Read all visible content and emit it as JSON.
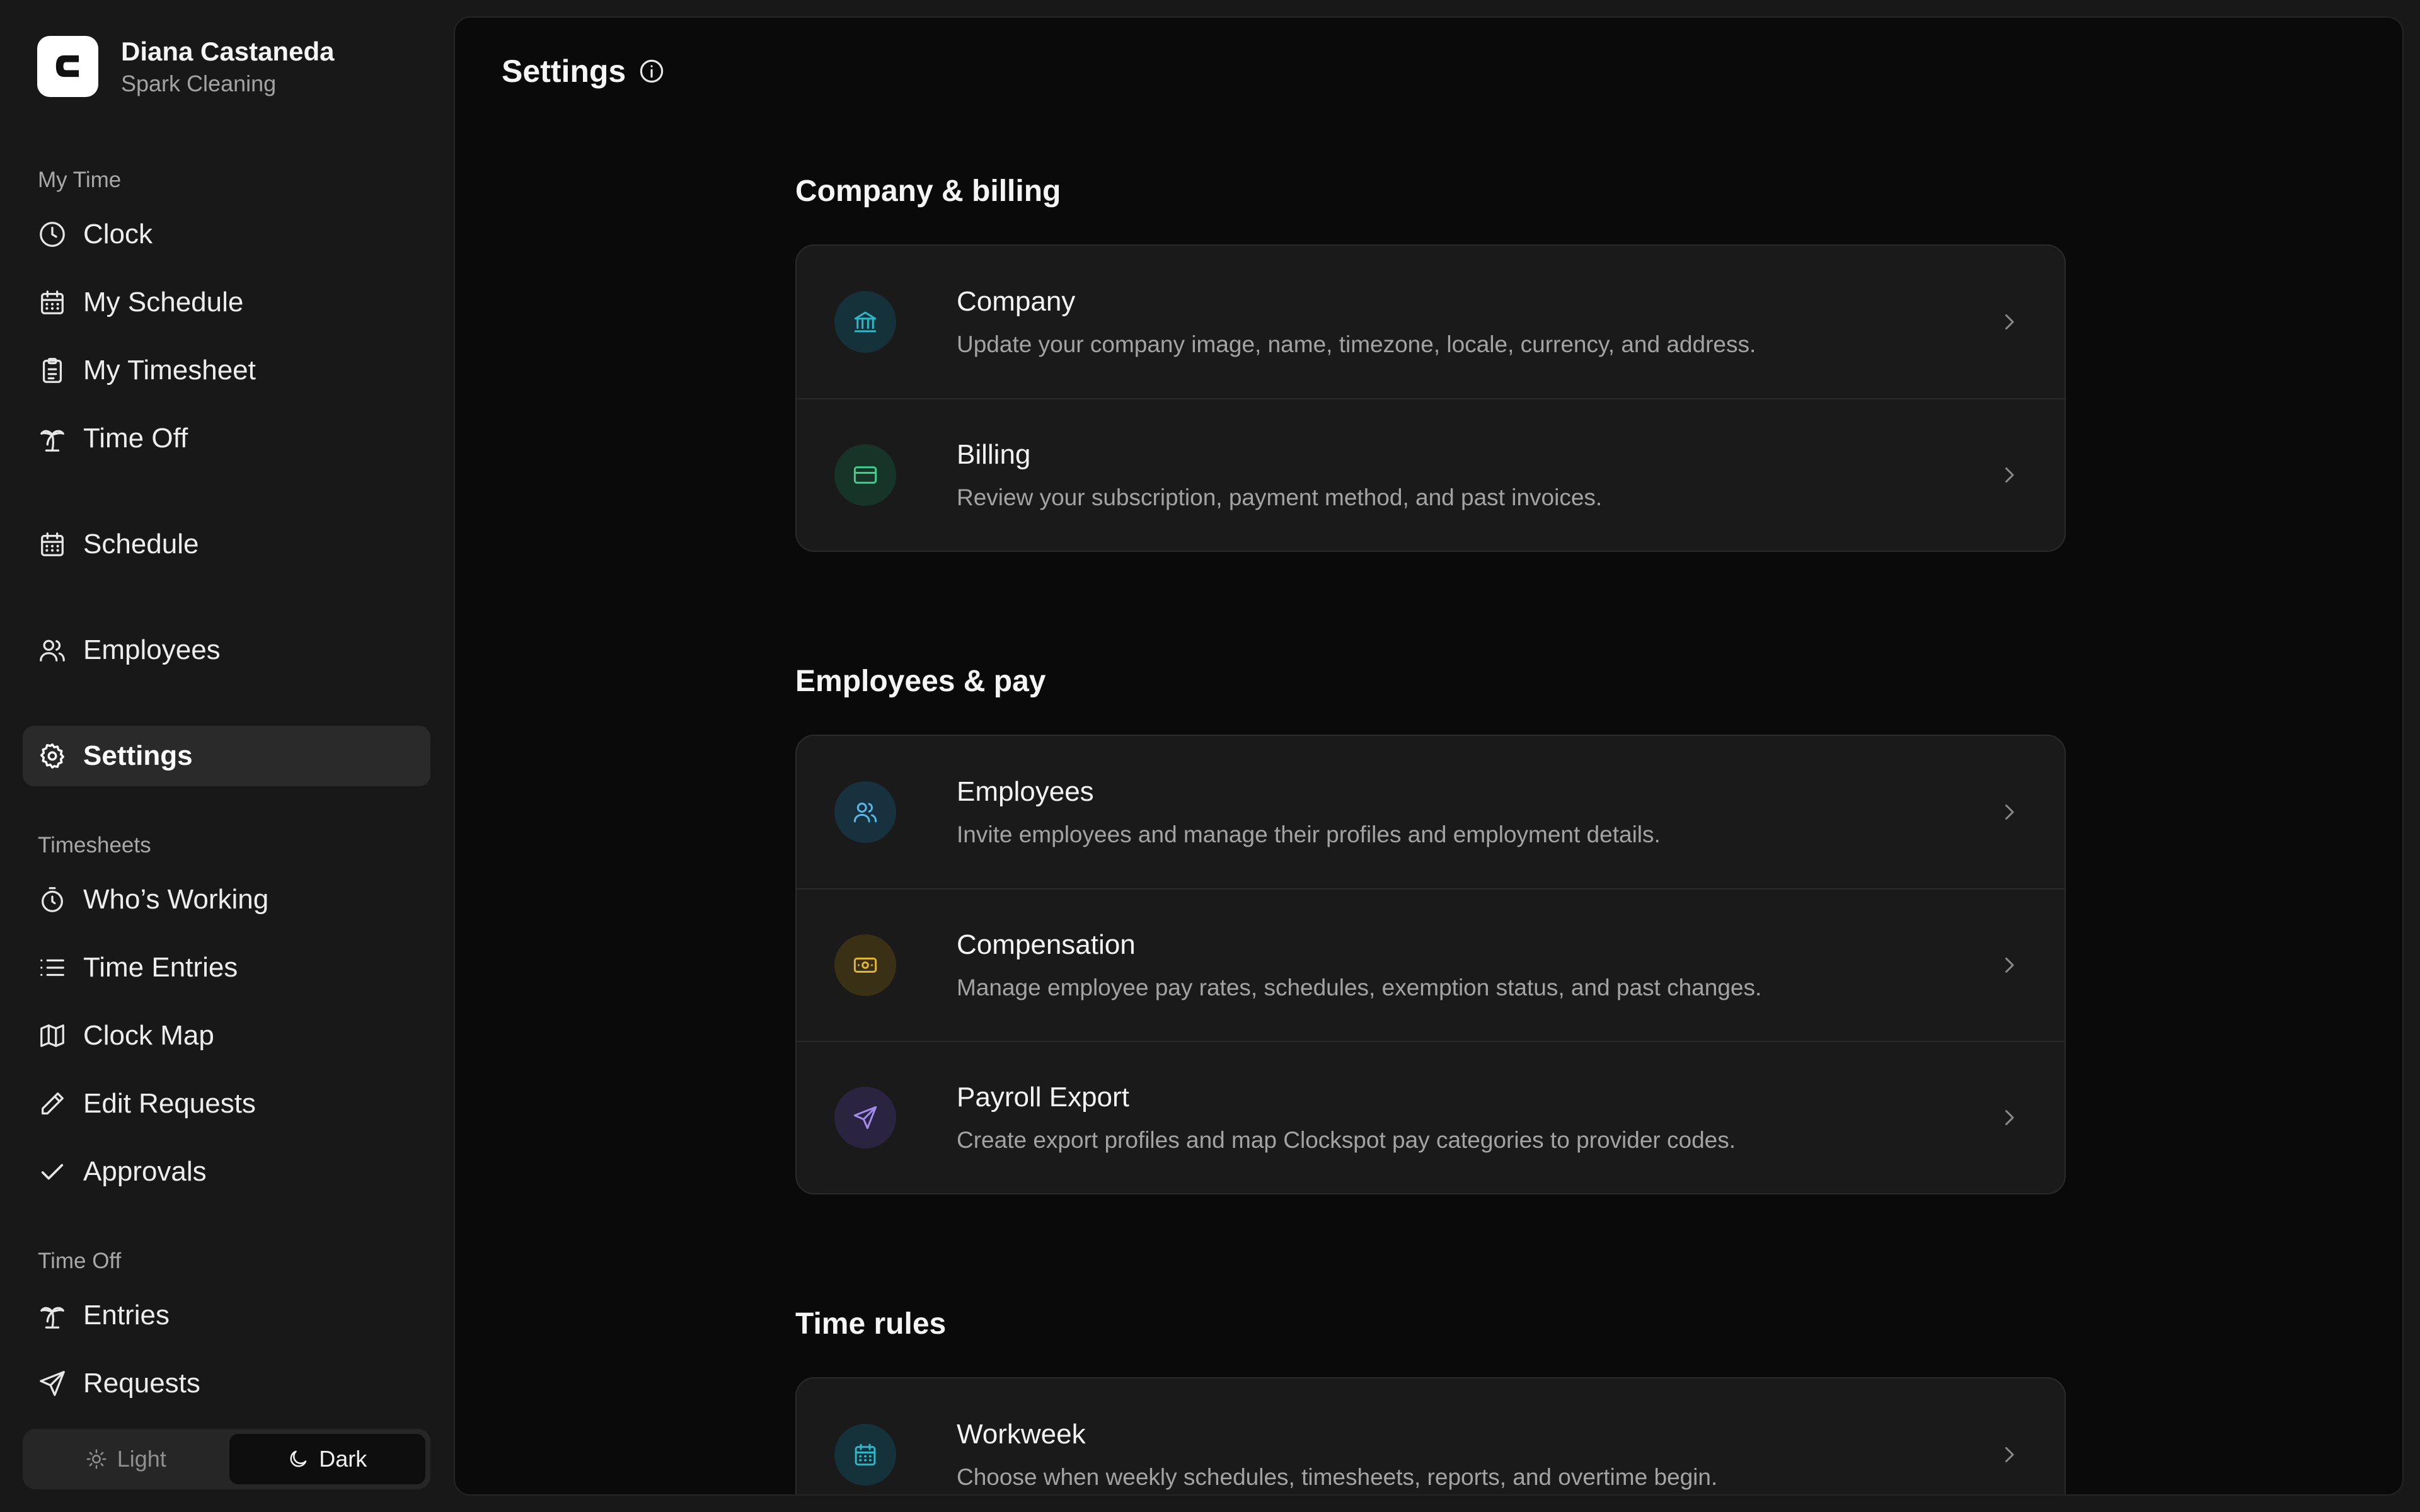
{
  "user": {
    "name": "Diana Castaneda",
    "company": "Spark Cleaning",
    "logo_letter": "C"
  },
  "sidebar": {
    "sections": {
      "my_time": "My Time",
      "timesheets": "Timesheets",
      "time_off": "Time Off"
    },
    "items": {
      "clock": "Clock",
      "my_schedule": "My Schedule",
      "my_timesheet": "My Timesheet",
      "time_off": "Time Off",
      "schedule": "Schedule",
      "employees": "Employees",
      "settings": "Settings",
      "whos_working": "Who’s Working",
      "time_entries": "Time Entries",
      "clock_map": "Clock Map",
      "edit_requests": "Edit Requests",
      "approvals": "Approvals",
      "entries": "Entries",
      "requests": "Requests"
    },
    "active_item": "settings",
    "theme": {
      "light": "Light",
      "dark": "Dark",
      "selected": "dark"
    }
  },
  "main": {
    "title": "Settings",
    "groups": [
      {
        "title": "Company & billing",
        "rows": [
          {
            "title": "Company",
            "desc": "Update your company image, name, timezone, locale, currency, and address.",
            "icon": "bank-icon",
            "color": "#2fb6c9"
          },
          {
            "title": "Billing",
            "desc": "Review your subscription, payment method, and past invoices.",
            "icon": "credit-card-icon",
            "color": "#3fcf8e"
          }
        ]
      },
      {
        "title": "Employees & pay",
        "rows": [
          {
            "title": "Employees",
            "desc": "Invite employees and manage their profiles and employment details.",
            "icon": "users-icon",
            "color": "#5ab8e8"
          },
          {
            "title": "Compensation",
            "desc": "Manage employee pay rates, schedules, exemption status, and past changes.",
            "icon": "banknote-icon",
            "color": "#e0b534"
          },
          {
            "title": "Payroll Export",
            "desc": "Create export profiles and map Clockspot pay categories to provider codes.",
            "icon": "send-icon",
            "color": "#a48bf0"
          }
        ]
      },
      {
        "title": "Time rules",
        "rows": [
          {
            "title": "Workweek",
            "desc": "Choose when weekly schedules, timesheets, reports, and overtime begin.",
            "icon": "calendar-icon",
            "color": "#2fb6c9"
          }
        ]
      }
    ]
  }
}
